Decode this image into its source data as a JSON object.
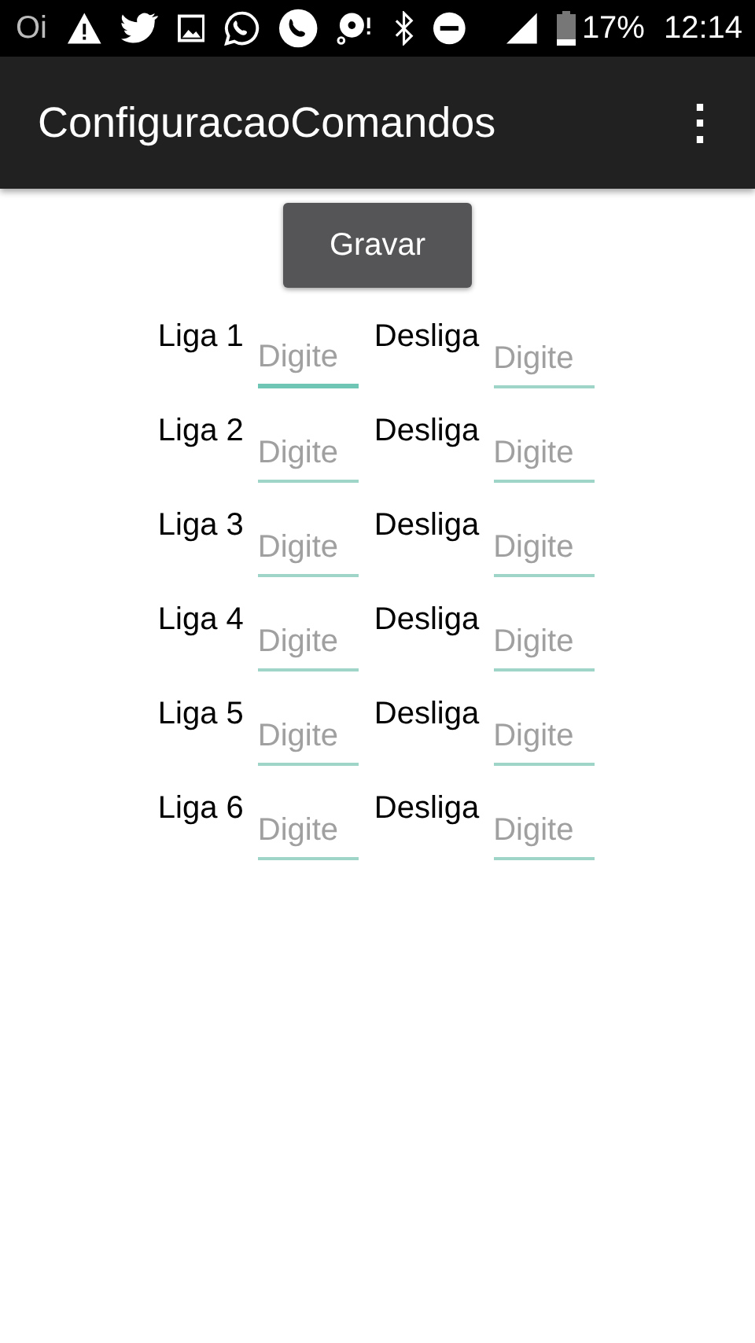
{
  "status_bar": {
    "carrier": "Oi",
    "battery": "17%",
    "time": "12:14"
  },
  "app_bar": {
    "title": "ConfiguracaoComandos",
    "menu": "⋮"
  },
  "save_button": "Gravar",
  "rows": [
    {
      "on_label": "Liga 1",
      "on_field": {
        "placeholder": "Digite",
        "focused": true
      },
      "off_label": "Desliga",
      "off_field": {
        "placeholder": "Digite",
        "focused": false
      }
    },
    {
      "on_label": "Liga 2",
      "on_field": {
        "placeholder": "Digite",
        "focused": false
      },
      "off_label": "Desliga",
      "off_field": {
        "placeholder": "Digite",
        "focused": false
      }
    },
    {
      "on_label": "Liga 3",
      "on_field": {
        "placeholder": "Digite",
        "focused": false
      },
      "off_label": "Desliga",
      "off_field": {
        "placeholder": "Digite",
        "focused": false
      }
    },
    {
      "on_label": "Liga 4",
      "on_field": {
        "placeholder": "Digite",
        "focused": false
      },
      "off_label": "Desliga",
      "off_field": {
        "placeholder": "Digite",
        "focused": false
      }
    },
    {
      "on_label": "Liga 5",
      "on_field": {
        "placeholder": "Digite",
        "focused": false
      },
      "off_label": "Desliga",
      "off_field": {
        "placeholder": "Digite",
        "focused": false
      }
    },
    {
      "on_label": "Liga 6",
      "on_field": {
        "placeholder": "Digite",
        "focused": false
      },
      "off_label": "Desliga",
      "off_field": {
        "placeholder": "Digite",
        "focused": false
      }
    }
  ]
}
